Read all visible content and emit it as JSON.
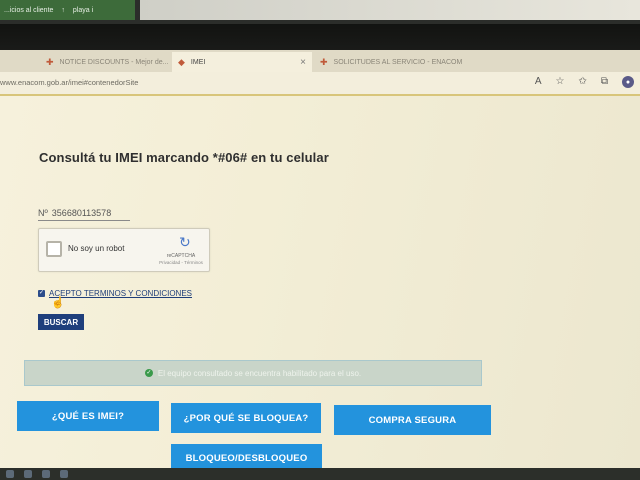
{
  "top_strip": {
    "item_1": "...icios al cliente",
    "item_2": "playa i"
  },
  "browser": {
    "tabs": [
      {
        "label": "NOTICE DISCOUNTS - Mejor de...",
        "active": false
      },
      {
        "label": "IMEI",
        "active": true
      },
      {
        "label": "SOLICITUDES AL SERVICIO - ENACOM",
        "active": false
      }
    ],
    "url": "www.enacom.gob.ar/imei#contenedorSite",
    "toolbar_icons": [
      "read-aloud-icon",
      "favorite-add-icon",
      "favorites-icon",
      "collections-icon",
      "profile-icon"
    ]
  },
  "page": {
    "heading": "Consultá tu IMEI marcando *#06# en tu celular",
    "imei_prefix": "Nº",
    "imei_value": "356680113578",
    "captcha": {
      "label": "No soy un robot",
      "brand": "reCAPTCHA",
      "links": "Privacidad - Términos"
    },
    "terms_label": "ACEPTO TERMINOS Y CONDICIONES",
    "terms_checked": true,
    "search_button": "BUSCAR",
    "status_message": "El equipo consultado se encuentra habilitado para el uso.",
    "nav": {
      "what_is_imei": "¿QUÉ ES IMEI?",
      "why_block": "¿POR QUÉ SE BLOQUEA?",
      "safe_purchase": "COMPRA SEGURA",
      "lock_unlock": "BLOQUEO/DESBLOQUEO"
    }
  },
  "colors": {
    "nav_blue": "#2393dd",
    "search_blue": "#1f3f7c",
    "status_bg": "#c9d5c9",
    "status_ok": "#3a9a4b"
  }
}
